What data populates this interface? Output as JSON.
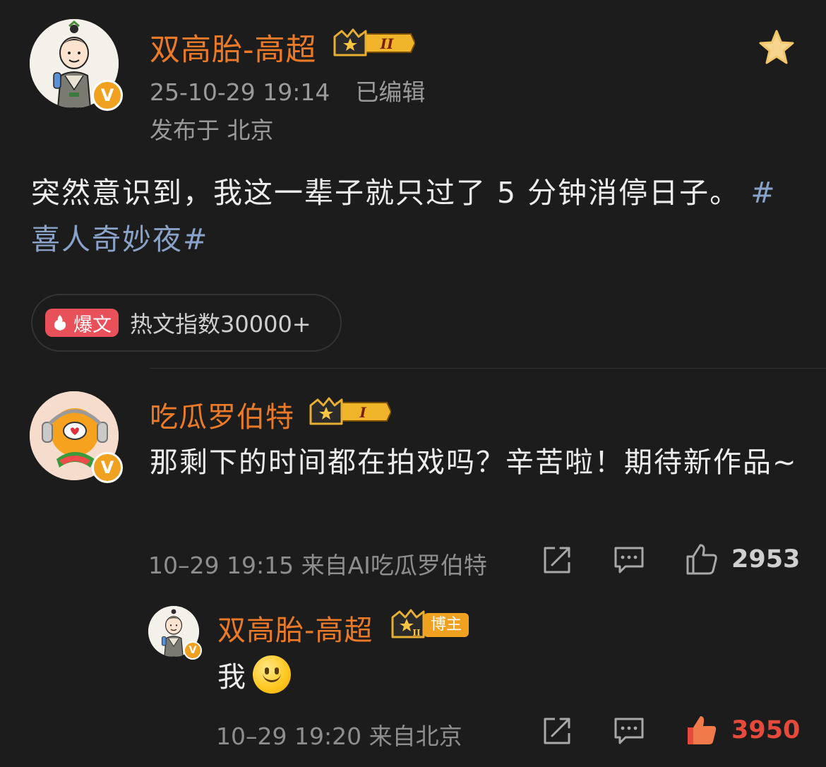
{
  "post": {
    "author": "双高胎-高超",
    "rank_badge": "II",
    "timestamp": "25-10-29 19:14",
    "edited": "已编辑",
    "location": "发布于 北京",
    "text": "突然意识到，我这一辈子就只过了 5 分钟消停日子。",
    "hashtag": "#喜人奇妙夜#",
    "hot_tag": "爆文",
    "hot_index": "热文指数30000+"
  },
  "comment": {
    "author": "吃瓜罗伯特",
    "rank_badge": "I",
    "text": "那剩下的时间都在拍戏吗？辛苦啦！期待新作品~",
    "meta": "10–29 19:15  来自AI吃瓜罗伯特",
    "likes": "2953"
  },
  "reply": {
    "author": "双高胎-高超",
    "rank_badge": "II",
    "blogger_tag": "博主",
    "text": "我",
    "meta": "10–29 19:20  来自北京",
    "likes": "3950"
  },
  "colors": {
    "background": "#1c1c1c",
    "username": "#eb7a28",
    "hashtag": "#8aa2c8",
    "verified": "#f0a120",
    "hot_tag": "#e9515a"
  }
}
